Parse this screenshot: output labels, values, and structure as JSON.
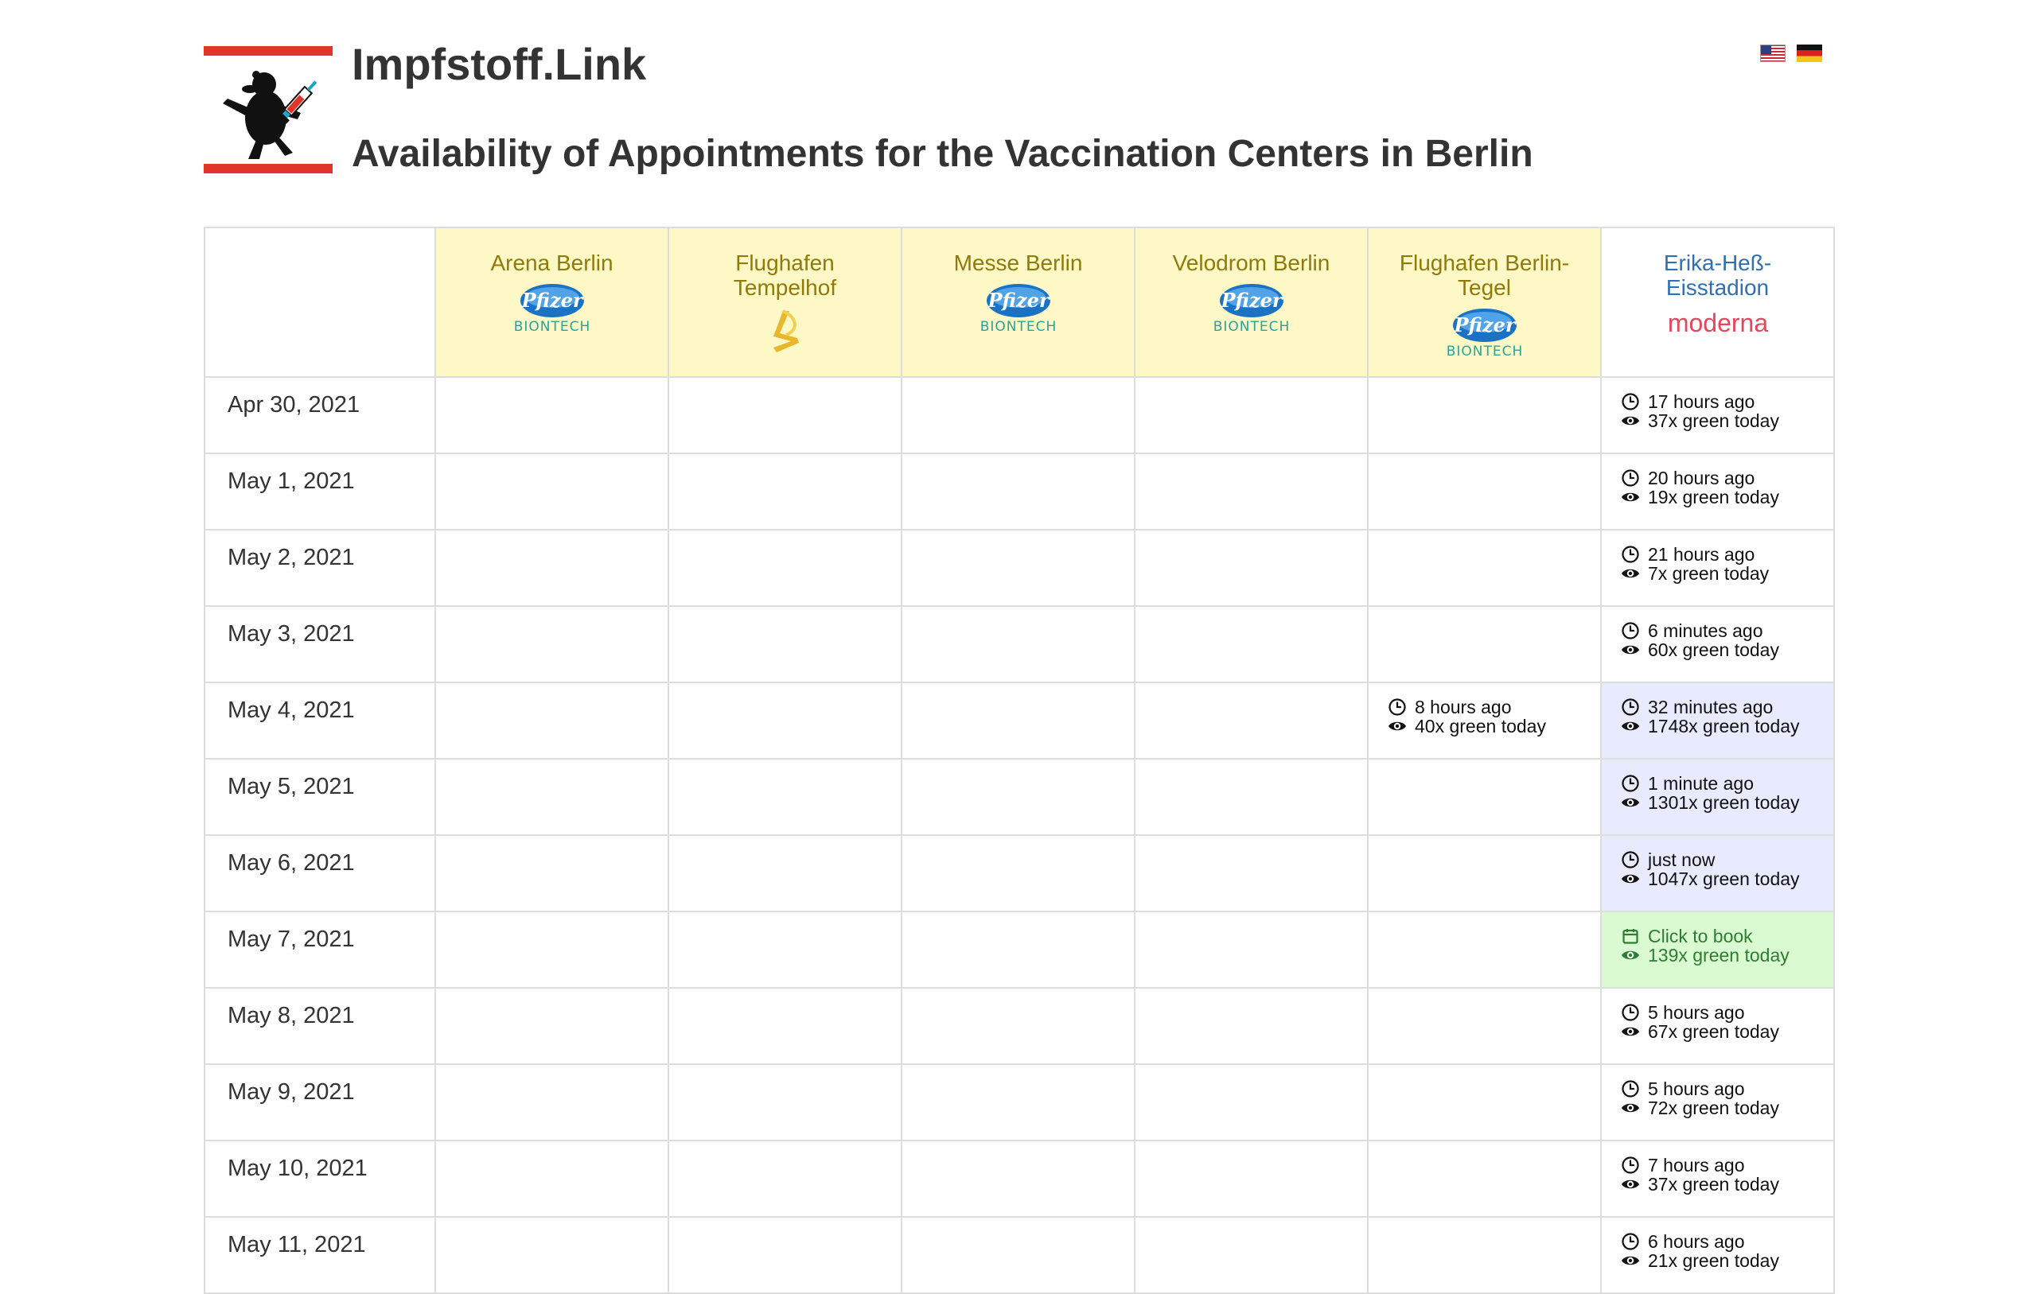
{
  "header": {
    "title": "Impfstoff.Link",
    "subtitle": "Availability of Appointments for the Vaccination Centers in Berlin",
    "languages": [
      "en",
      "de"
    ]
  },
  "colors": {
    "header_bg": "#fdf8c6",
    "center_name": "#8f7a0a",
    "moderna_name": "#2f6fb3",
    "recent_bg": "#e8eafd",
    "bookable_bg": "#dafad2",
    "bookable_text": "#2e7d32",
    "flag_red": "#e1342b"
  },
  "centers": [
    {
      "name": "Arena Berlin",
      "vaccine": "pfizer-biontech"
    },
    {
      "name": "Flughafen Tempelhof",
      "vaccine": "astrazeneca"
    },
    {
      "name": "Messe Berlin",
      "vaccine": "pfizer-biontech"
    },
    {
      "name": "Velodrom Berlin",
      "vaccine": "pfizer-biontech"
    },
    {
      "name": "Flughafen Berlin-Tegel",
      "vaccine": "pfizer-biontech"
    },
    {
      "name": "Erika-Heß-Eisstadion",
      "vaccine": "moderna"
    }
  ],
  "rows": [
    {
      "date": "Apr 30, 2021",
      "cells": [
        null,
        null,
        null,
        null,
        null,
        {
          "status": "17 hours ago",
          "count": "37x green today",
          "style": "plain"
        }
      ]
    },
    {
      "date": "May 1, 2021",
      "cells": [
        null,
        null,
        null,
        null,
        null,
        {
          "status": "20 hours ago",
          "count": "19x green today",
          "style": "plain"
        }
      ]
    },
    {
      "date": "May 2, 2021",
      "cells": [
        null,
        null,
        null,
        null,
        null,
        {
          "status": "21 hours ago",
          "count": "7x green today",
          "style": "plain"
        }
      ]
    },
    {
      "date": "May 3, 2021",
      "cells": [
        null,
        null,
        null,
        null,
        null,
        {
          "status": "6 minutes ago",
          "count": "60x green today",
          "style": "plain"
        }
      ]
    },
    {
      "date": "May 4, 2021",
      "cells": [
        null,
        null,
        null,
        null,
        {
          "status": "8 hours ago",
          "count": "40x green today",
          "style": "plain"
        },
        {
          "status": "32 minutes ago",
          "count": "1748x green today",
          "style": "recent"
        }
      ]
    },
    {
      "date": "May 5, 2021",
      "cells": [
        null,
        null,
        null,
        null,
        null,
        {
          "status": "1 minute ago",
          "count": "1301x green today",
          "style": "recent"
        }
      ]
    },
    {
      "date": "May 6, 2021",
      "cells": [
        null,
        null,
        null,
        null,
        null,
        {
          "status": "just now",
          "count": "1047x green today",
          "style": "recent"
        }
      ]
    },
    {
      "date": "May 7, 2021",
      "cells": [
        null,
        null,
        null,
        null,
        null,
        {
          "status": "Click to book",
          "count": "139x green today",
          "style": "bookable"
        }
      ]
    },
    {
      "date": "May 8, 2021",
      "cells": [
        null,
        null,
        null,
        null,
        null,
        {
          "status": "5 hours ago",
          "count": "67x green today",
          "style": "plain"
        }
      ]
    },
    {
      "date": "May 9, 2021",
      "cells": [
        null,
        null,
        null,
        null,
        null,
        {
          "status": "5 hours ago",
          "count": "72x green today",
          "style": "plain"
        }
      ]
    },
    {
      "date": "May 10, 2021",
      "cells": [
        null,
        null,
        null,
        null,
        null,
        {
          "status": "7 hours ago",
          "count": "37x green today",
          "style": "plain"
        }
      ]
    },
    {
      "date": "May 11, 2021",
      "cells": [
        null,
        null,
        null,
        null,
        null,
        {
          "status": "6 hours ago",
          "count": "21x green today",
          "style": "plain"
        }
      ]
    }
  ]
}
